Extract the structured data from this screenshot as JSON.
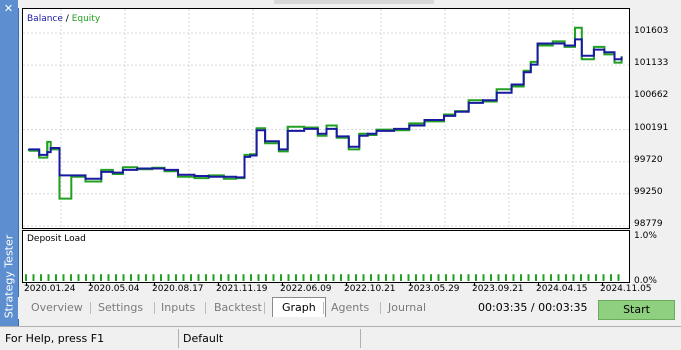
{
  "window": {
    "side_title": "Strategy Tester",
    "close_glyph": "✕"
  },
  "chart": {
    "legend_balance": "Balance",
    "legend_separator": "/",
    "legend_equity": "Equity",
    "load_title": "Deposit Load",
    "colors": {
      "balance": "#1a1aa0",
      "equity": "#22a022",
      "load": "#22a022"
    }
  },
  "chart_data": [
    {
      "type": "line",
      "title": "",
      "series": [
        {
          "name": "Balance",
          "x": [
            "2020-01-15",
            "2020-02-15",
            "2020-03-10",
            "2020-03-20",
            "2020-04-15",
            "2020-05-20",
            "2020-07-01",
            "2020-08-17",
            "2020-09-20",
            "2020-10-20",
            "2020-12-01",
            "2021-01-15",
            "2021-02-20",
            "2021-04-01",
            "2021-05-20",
            "2021-07-01",
            "2021-08-15",
            "2021-09-20",
            "2021-10-15",
            "2021-11-01",
            "2021-11-20",
            "2021-12-15",
            "2022-01-25",
            "2022-02-20",
            "2022-04-10",
            "2022-05-20",
            "2022-06-15",
            "2022-07-15",
            "2022-08-20",
            "2022-09-20",
            "2022-10-15",
            "2022-11-10",
            "2023-01-01",
            "2023-02-15",
            "2023-04-01",
            "2023-05-29",
            "2023-07-01",
            "2023-08-10",
            "2023-09-21",
            "2023-11-01",
            "2023-12-15",
            "2024-01-20",
            "2024-02-10",
            "2024-03-01",
            "2024-04-15",
            "2024-05-20",
            "2024-06-20",
            "2024-07-10",
            "2024-08-15",
            "2024-09-15",
            "2024-10-15",
            "2024-11-05"
          ],
          "values": [
            99900,
            99820,
            99860,
            99920,
            99520,
            99520,
            99470,
            99570,
            99560,
            99600,
            99620,
            99620,
            99600,
            99530,
            99510,
            99500,
            99500,
            99490,
            99790,
            99810,
            100180,
            100020,
            99900,
            100170,
            100200,
            100130,
            100200,
            100090,
            99940,
            100100,
            100130,
            100170,
            100200,
            100250,
            100330,
            100390,
            100450,
            100580,
            100620,
            100730,
            100850,
            101030,
            101140,
            101450,
            101450,
            101420,
            101510,
            101270,
            101360,
            101320,
            101220,
            101250
          ]
        },
        {
          "name": "Equity",
          "x": [
            "2020-01-15",
            "2020-02-15",
            "2020-03-10",
            "2020-03-20",
            "2020-04-15",
            "2020-05-20",
            "2020-07-01",
            "2020-08-17",
            "2020-09-20",
            "2020-10-20",
            "2020-12-01",
            "2021-01-15",
            "2021-02-20",
            "2021-04-01",
            "2021-05-20",
            "2021-07-01",
            "2021-08-15",
            "2021-09-20",
            "2021-10-15",
            "2021-11-01",
            "2021-11-20",
            "2021-12-15",
            "2022-01-25",
            "2022-02-20",
            "2022-04-10",
            "2022-05-20",
            "2022-06-15",
            "2022-07-15",
            "2022-08-20",
            "2022-09-20",
            "2022-10-15",
            "2022-11-10",
            "2023-01-01",
            "2023-02-15",
            "2023-04-01",
            "2023-05-29",
            "2023-07-01",
            "2023-08-10",
            "2023-09-21",
            "2023-11-01",
            "2023-12-15",
            "2024-01-20",
            "2024-02-10",
            "2024-03-01",
            "2024-04-15",
            "2024-05-20",
            "2024-06-20",
            "2024-07-10",
            "2024-08-15",
            "2024-09-15",
            "2024-10-15",
            "2024-11-05"
          ],
          "values": [
            99880,
            99780,
            100010,
            99900,
            99180,
            99500,
            99430,
            99600,
            99540,
            99640,
            99610,
            99630,
            99580,
            99500,
            99480,
            99520,
            99470,
            99480,
            99820,
            99830,
            100210,
            99990,
            99870,
            100230,
            100220,
            100100,
            100250,
            100070,
            99900,
            100130,
            100110,
            100190,
            100180,
            100280,
            100310,
            100410,
            100460,
            100620,
            100600,
            100780,
            100820,
            101050,
            101180,
            101420,
            101480,
            101400,
            101680,
            101220,
            101400,
            101290,
            101170,
            101260
          ]
        }
      ],
      "y_ticks": [
        "101603",
        "101133",
        "100662",
        "100191",
        "99720",
        "99250",
        "98779"
      ],
      "ylim": [
        98779,
        101603
      ],
      "x_ticks": [
        "2020.01.24",
        "2020.05.04",
        "2020.08.17",
        "2021.11.19",
        "2022.06.09",
        "2022.10.21",
        "2023.05.29",
        "2023.09.21",
        "2024.04.15",
        "2024.11.05"
      ],
      "legend": "top-left",
      "grid": true
    },
    {
      "type": "bar",
      "title": "Deposit Load",
      "y_ticks": [
        "1.0%",
        "0.0%"
      ],
      "ylim": [
        0,
        1
      ],
      "values": [
        0.17,
        0.17,
        0.17,
        0.17,
        0.17,
        0.17,
        0.17,
        0.17,
        0.17,
        0.17,
        0.17,
        0.17,
        0.17,
        0.17,
        0.17,
        0.17,
        0.17,
        0.17,
        0.17,
        0.17,
        0.17,
        0.17,
        0.17,
        0.17,
        0.17,
        0.17,
        0.17,
        0.17,
        0.17,
        0.17,
        0.17,
        0.17,
        0.17,
        0.17,
        0.17,
        0.17,
        0.17,
        0.17,
        0.17,
        0.17,
        0.17,
        0.17,
        0.17,
        0.17,
        0.17,
        0.17,
        0.17,
        0.17,
        0.17,
        0.17,
        0.17,
        0.17,
        0.17,
        0.17,
        0.17,
        0.17,
        0.17,
        0.17,
        0.17,
        0.17,
        0.17,
        0.17,
        0.17,
        0.17,
        0.17,
        0.17,
        0.17,
        0.17,
        0.17,
        0.17,
        0.17,
        0.17,
        0.17,
        0.17,
        0.17,
        0.17,
        0.17,
        0.17,
        0.17,
        0.17
      ]
    }
  ],
  "tabs": [
    {
      "label": "Overview",
      "active": false
    },
    {
      "label": "Settings",
      "active": false
    },
    {
      "label": "Inputs",
      "active": false
    },
    {
      "label": "Backtest",
      "active": false
    },
    {
      "label": "Graph",
      "active": true
    },
    {
      "label": "Agents",
      "active": false
    },
    {
      "label": "Journal",
      "active": false
    }
  ],
  "timer": "00:03:35 / 00:03:35",
  "start_button": "Start",
  "status_bar": {
    "help": "For Help, press F1",
    "profile": "Default"
  }
}
